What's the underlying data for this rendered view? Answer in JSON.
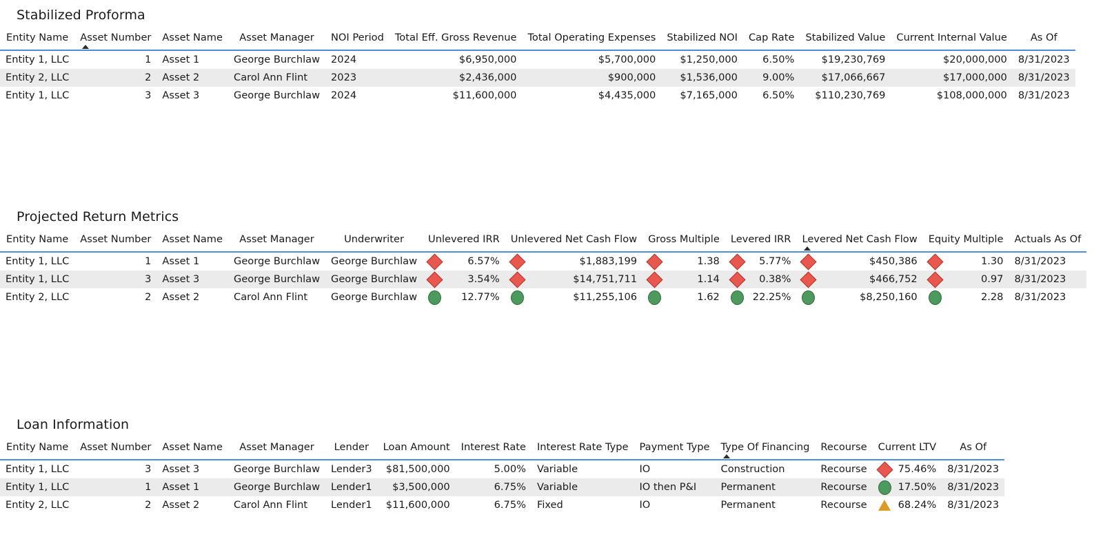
{
  "sections": [
    {
      "id": "proforma",
      "title": "Stabilized Proforma",
      "sort_column_index": 1,
      "columns": [
        {
          "label": "Entity Name",
          "align": "txt"
        },
        {
          "label": "Asset Number",
          "align": "num"
        },
        {
          "label": "Asset Name",
          "align": "txt"
        },
        {
          "label": "Asset Manager",
          "align": "txt"
        },
        {
          "label": "NOI Period",
          "align": "txt"
        },
        {
          "label": "Total Eff. Gross Revenue",
          "align": "num"
        },
        {
          "label": "Total Operating Expenses",
          "align": "num"
        },
        {
          "label": "Stabilized NOI",
          "align": "num"
        },
        {
          "label": "Cap Rate",
          "align": "num"
        },
        {
          "label": "Stabilized Value",
          "align": "num"
        },
        {
          "label": "Current Internal Value",
          "align": "num"
        },
        {
          "label": "As Of",
          "align": "txt"
        }
      ],
      "rows": [
        [
          "Entity 1, LLC",
          "1",
          "Asset 1",
          "George Burchlaw",
          "2024",
          "$6,950,000",
          "$5,700,000",
          "$1,250,000",
          "6.50%",
          "$19,230,769",
          "$20,000,000",
          "8/31/2023"
        ],
        [
          "Entity 2, LLC",
          "2",
          "Asset 2",
          "Carol Ann Flint",
          "2023",
          "$2,436,000",
          "$900,000",
          "$1,536,000",
          "9.00%",
          "$17,066,667",
          "$17,000,000",
          "8/31/2023"
        ],
        [
          "Entity 1, LLC",
          "3",
          "Asset 3",
          "George Burchlaw",
          "2024",
          "$11,600,000",
          "$4,435,000",
          "$7,165,000",
          "6.50%",
          "$110,230,769",
          "$108,000,000",
          "8/31/2023"
        ]
      ]
    },
    {
      "id": "returns",
      "title": "Projected Return Metrics",
      "sort_column_index": 9,
      "columns": [
        {
          "label": "Entity Name",
          "align": "txt"
        },
        {
          "label": "Asset Number",
          "align": "num"
        },
        {
          "label": "Asset Name",
          "align": "txt"
        },
        {
          "label": "Asset Manager",
          "align": "txt"
        },
        {
          "label": "Underwriter",
          "align": "txt"
        },
        {
          "label": "Unlevered IRR",
          "align": "kpi"
        },
        {
          "label": "Unlevered Net Cash Flow",
          "align": "kpi"
        },
        {
          "label": "Gross Multiple",
          "align": "kpi"
        },
        {
          "label": "Levered IRR",
          "align": "kpi"
        },
        {
          "label": "Levered Net Cash Flow",
          "align": "kpi"
        },
        {
          "label": "Equity Multiple",
          "align": "kpi"
        },
        {
          "label": "Actuals As Of",
          "align": "txt"
        }
      ],
      "rows": [
        {
          "cells": [
            "Entity 1, LLC",
            "1",
            "Asset 1",
            "George Burchlaw",
            "George Burchlaw"
          ],
          "kpis": [
            {
              "shape": "diamond",
              "value": "6.57%"
            },
            {
              "shape": "diamond",
              "value": "$1,883,199"
            },
            {
              "shape": "diamond",
              "value": "1.38"
            },
            {
              "shape": "diamond",
              "value": "5.77%"
            },
            {
              "shape": "diamond",
              "value": "$450,386"
            },
            {
              "shape": "diamond",
              "value": "1.30"
            }
          ],
          "tail": "8/31/2023"
        },
        {
          "cells": [
            "Entity 1, LLC",
            "3",
            "Asset 3",
            "George Burchlaw",
            "George Burchlaw"
          ],
          "kpis": [
            {
              "shape": "diamond",
              "value": "3.54%"
            },
            {
              "shape": "diamond",
              "value": "$14,751,711"
            },
            {
              "shape": "diamond",
              "value": "1.14"
            },
            {
              "shape": "diamond",
              "value": "0.38%"
            },
            {
              "shape": "diamond",
              "value": "$466,752"
            },
            {
              "shape": "diamond",
              "value": "0.97"
            }
          ],
          "tail": "8/31/2023"
        },
        {
          "cells": [
            "Entity 2, LLC",
            "2",
            "Asset 2",
            "Carol Ann Flint",
            "George Burchlaw"
          ],
          "kpis": [
            {
              "shape": "circle",
              "value": "12.77%"
            },
            {
              "shape": "circle",
              "value": "$11,255,106"
            },
            {
              "shape": "circle",
              "value": "1.62"
            },
            {
              "shape": "circle",
              "value": "22.25%"
            },
            {
              "shape": "circle",
              "value": "$8,250,160"
            },
            {
              "shape": "circle",
              "value": "2.28"
            }
          ],
          "tail": "8/31/2023"
        }
      ]
    },
    {
      "id": "loans",
      "title": "Loan Information",
      "sort_column_index": 9,
      "columns": [
        {
          "label": "Entity Name",
          "align": "txt"
        },
        {
          "label": "Asset Number",
          "align": "num"
        },
        {
          "label": "Asset Name",
          "align": "txt"
        },
        {
          "label": "Asset Manager",
          "align": "txt"
        },
        {
          "label": "Lender",
          "align": "txt"
        },
        {
          "label": "Loan Amount",
          "align": "num"
        },
        {
          "label": "Interest Rate",
          "align": "num"
        },
        {
          "label": "Interest Rate Type",
          "align": "txt"
        },
        {
          "label": "Payment Type",
          "align": "txt"
        },
        {
          "label": "Type Of Financing",
          "align": "txt"
        },
        {
          "label": "Recourse",
          "align": "txt"
        },
        {
          "label": "Current LTV",
          "align": "kpi"
        },
        {
          "label": "As Of",
          "align": "txt"
        }
      ],
      "rows": [
        {
          "cells": [
            "Entity 1, LLC",
            "3",
            "Asset 3",
            "George Burchlaw",
            "Lender3",
            "$81,500,000",
            "5.00%",
            "Variable",
            "IO",
            "Construction",
            "Recourse"
          ],
          "kpis": [
            {
              "shape": "diamond",
              "value": "75.46%"
            }
          ],
          "tail": "8/31/2023"
        },
        {
          "cells": [
            "Entity 1, LLC",
            "1",
            "Asset 1",
            "George Burchlaw",
            "Lender1",
            "$3,500,000",
            "6.75%",
            "Variable",
            "IO then P&I",
            "Permanent",
            "Recourse"
          ],
          "kpis": [
            {
              "shape": "circle",
              "value": "17.50%"
            }
          ],
          "tail": "8/31/2023"
        },
        {
          "cells": [
            "Entity 2, LLC",
            "2",
            "Asset 2",
            "Carol Ann Flint",
            "Lender1",
            "$11,600,000",
            "6.75%",
            "Fixed",
            "IO",
            "Permanent",
            "Recourse"
          ],
          "kpis": [
            {
              "shape": "triangle",
              "value": "68.24%"
            }
          ],
          "tail": "8/31/2023"
        }
      ]
    }
  ],
  "colors": {
    "header_rule": "#4a90d9",
    "band": "#ebebeb",
    "kpi_red": "#e8584e",
    "kpi_green": "#4d9a5e",
    "kpi_amber": "#dd9b24"
  }
}
